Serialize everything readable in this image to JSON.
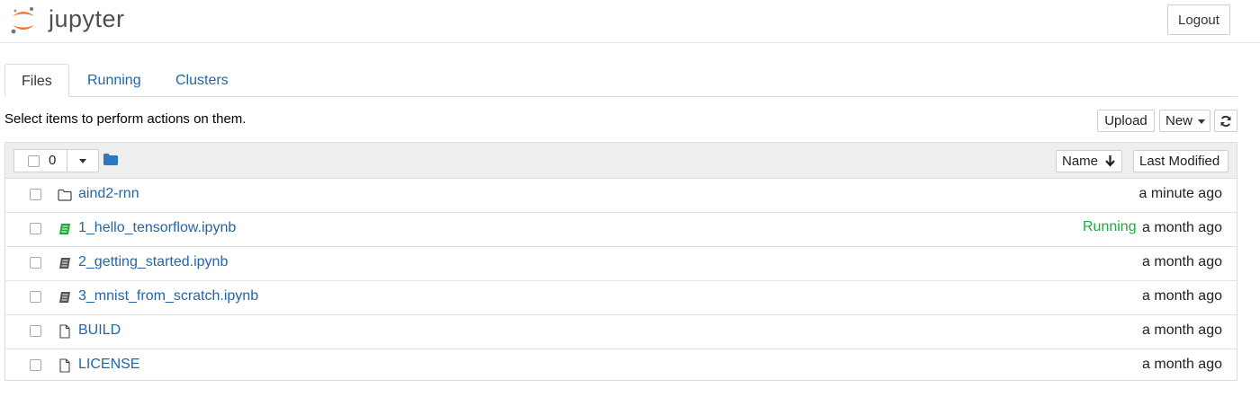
{
  "header": {
    "logo_text": "jupyter",
    "logout_label": "Logout"
  },
  "tabs": [
    {
      "label": "Files",
      "active": true
    },
    {
      "label": "Running",
      "active": false
    },
    {
      "label": "Clusters",
      "active": false
    }
  ],
  "toolbar": {
    "hint": "Select items to perform actions on them.",
    "upload_label": "Upload",
    "new_label": "New"
  },
  "list_header": {
    "selected_count": "0",
    "sort_name_label": "Name",
    "last_modified_label": "Last Modified"
  },
  "files": [
    {
      "name": "aind2-rnn",
      "icon": "folder-icon",
      "status": "",
      "modified": "a minute ago"
    },
    {
      "name": "1_hello_tensorflow.ipynb",
      "icon": "notebook-running-icon",
      "status": "Running",
      "modified": "a month ago"
    },
    {
      "name": "2_getting_started.ipynb",
      "icon": "notebook-icon",
      "status": "",
      "modified": "a month ago"
    },
    {
      "name": "3_mnist_from_scratch.ipynb",
      "icon": "notebook-icon",
      "status": "",
      "modified": "a month ago"
    },
    {
      "name": "BUILD",
      "icon": "file-icon",
      "status": "",
      "modified": "a month ago"
    },
    {
      "name": "LICENSE",
      "icon": "file-icon",
      "status": "",
      "modified": "a month ago"
    }
  ],
  "colors": {
    "brand_orange": "#f37726",
    "link_blue": "#2266aa",
    "running_green": "#1faa3e"
  }
}
